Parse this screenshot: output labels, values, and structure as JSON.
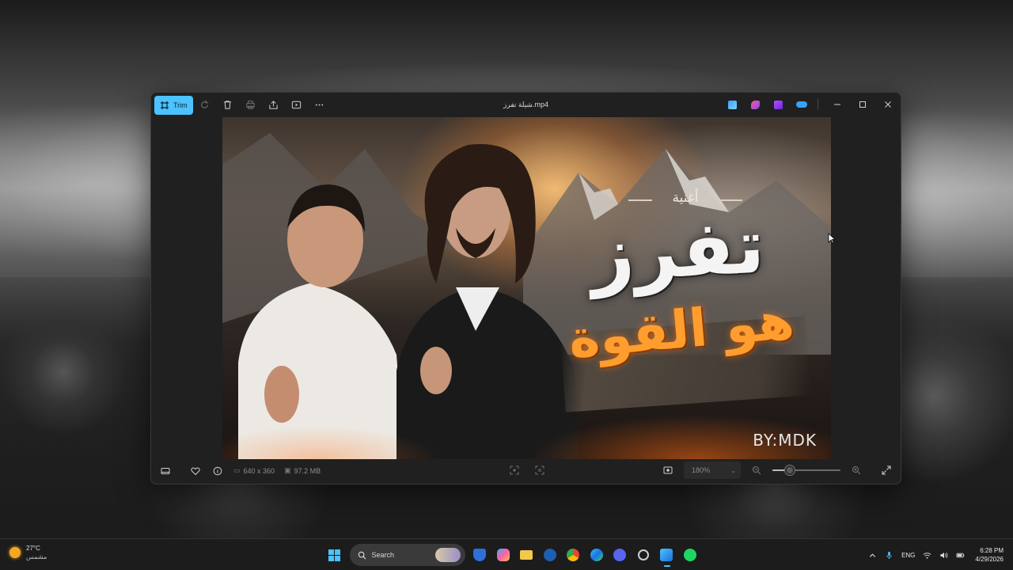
{
  "window": {
    "title": "شيلة تفرز.mp4",
    "toolbar": {
      "trim_label": "Trim",
      "tools": [
        "rotate-icon",
        "delete-icon",
        "print-icon",
        "share-icon",
        "slideshow-icon",
        "more-icon"
      ]
    },
    "app_icons": [
      "clipchamp-icon",
      "designer-icon",
      "premiere-icon",
      "onedrive-icon"
    ],
    "controls": [
      "minimize-icon",
      "maximize-icon",
      "close-icon"
    ]
  },
  "media": {
    "small_text": "أغنية",
    "title_text": "تفرز",
    "subtitle_text": "هو القوة",
    "credit_text": "BY:MDK"
  },
  "bottom_bar": {
    "dimensions": "640 x 360",
    "file_size": "97.2 MB",
    "zoom": "180%",
    "zoom_slider_fraction": 0.25
  },
  "taskbar": {
    "weather": {
      "temp": "27°C",
      "condition": "مشمس"
    },
    "search_label": "Search",
    "tray": {
      "language": "ENG",
      "time": "6:28 PM",
      "date": "4/29/2026"
    }
  },
  "colors": {
    "accent": "#4cc2ff",
    "window_bg": "#202020",
    "poster_orange": "#ff9d2e"
  }
}
